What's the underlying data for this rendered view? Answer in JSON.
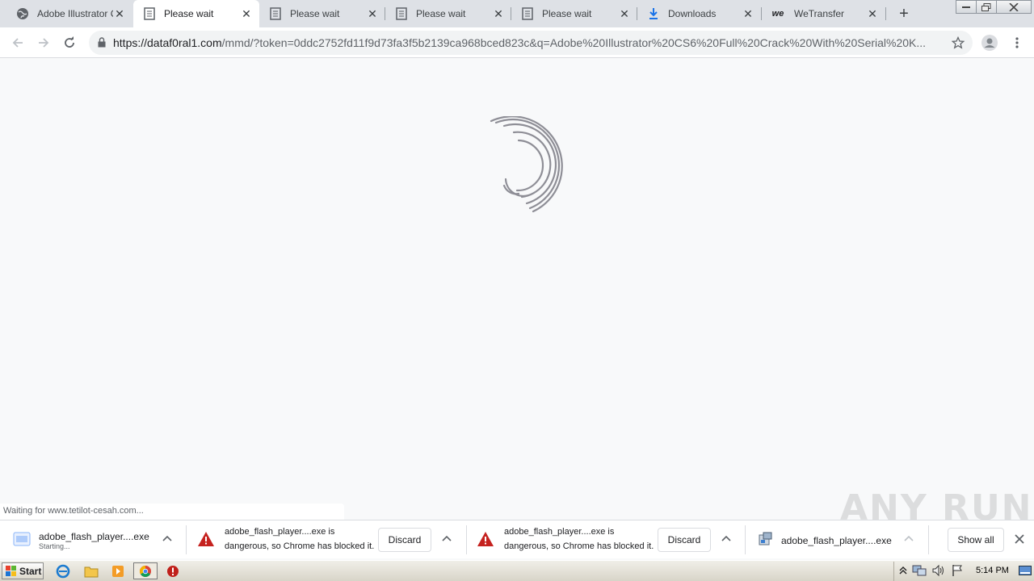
{
  "tabs": [
    {
      "title": "Adobe Illustrator C",
      "favicon": "globe-icon",
      "active": false
    },
    {
      "title": "Please wait",
      "favicon": "page-icon",
      "active": true
    },
    {
      "title": "Please wait",
      "favicon": "page-icon",
      "active": false
    },
    {
      "title": "Please wait",
      "favicon": "page-icon",
      "active": false
    },
    {
      "title": "Please wait",
      "favicon": "page-icon",
      "active": false
    },
    {
      "title": "Downloads",
      "favicon": "download-icon",
      "active": false
    },
    {
      "title": "WeTransfer",
      "favicon": "wetransfer-icon",
      "active": false
    }
  ],
  "toolbar": {
    "url_host": "https://dataf0ral1.com",
    "url_rest": "/mmd/?token=0ddc2752fd11f9d73fa3f5b2139ca968bced823c&q=Adobe%20Illustrator%20CS6%20Full%20Crack%20With%20Serial%20K..."
  },
  "status_bubble": "Waiting for www.tetilot-cesah.com...",
  "downloads": [
    {
      "name": "adobe_flash_player....exe",
      "status": "Starting..."
    },
    {
      "line1": "adobe_flash_player....exe is",
      "line2": "dangerous, so Chrome has blocked it.",
      "action": "Discard"
    },
    {
      "line1": "adobe_flash_player....exe is",
      "line2": "dangerous, so Chrome has blocked it.",
      "action": "Discard"
    },
    {
      "name": "adobe_flash_player....exe"
    }
  ],
  "shelf": {
    "show_all": "Show all"
  },
  "watermark": "ANY RUN",
  "taskbar": {
    "start": "Start",
    "clock": "5:14 PM"
  },
  "colors": {
    "tabstrip": "#dee1e6",
    "accent": "#1a73e8",
    "danger": "#c5221f",
    "spinner": "#8e8e96"
  }
}
